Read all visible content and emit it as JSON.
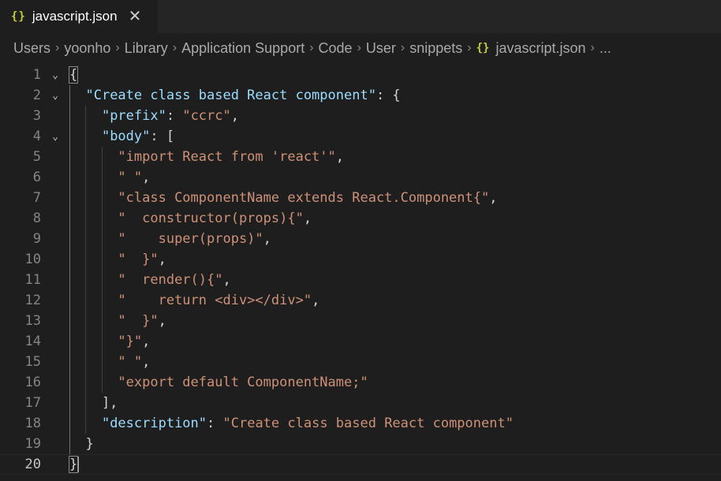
{
  "tab": {
    "icon": "{}",
    "title": "javascript.json",
    "close": "✕"
  },
  "breadcrumb": [
    "Users",
    "yoonho",
    "Library",
    "Application Support",
    "Code",
    "User",
    "snippets"
  ],
  "breadcrumb_file": "javascript.json",
  "breadcrumb_more": "...",
  "colors": {
    "string": "#ce9178",
    "key": "#9cdcfe",
    "punct": "#d4d4d4"
  },
  "lines": [
    {
      "n": "1",
      "fold": true,
      "tokens": [
        {
          "t": "{",
          "c": "pun"
        }
      ]
    },
    {
      "n": "2",
      "fold": true,
      "tokens": [
        {
          "t": "  ",
          "c": "pun"
        },
        {
          "t": "\"Create class based React component\"",
          "c": "key"
        },
        {
          "t": ": {",
          "c": "pun"
        }
      ]
    },
    {
      "n": "3",
      "fold": false,
      "tokens": [
        {
          "t": "    ",
          "c": "pun"
        },
        {
          "t": "\"prefix\"",
          "c": "key"
        },
        {
          "t": ": ",
          "c": "pun"
        },
        {
          "t": "\"ccrc\"",
          "c": "str"
        },
        {
          "t": ",",
          "c": "pun"
        }
      ]
    },
    {
      "n": "4",
      "fold": true,
      "tokens": [
        {
          "t": "    ",
          "c": "pun"
        },
        {
          "t": "\"body\"",
          "c": "key"
        },
        {
          "t": ": [",
          "c": "pun"
        }
      ]
    },
    {
      "n": "5",
      "fold": false,
      "tokens": [
        {
          "t": "      ",
          "c": "pun"
        },
        {
          "t": "\"import React from 'react'\"",
          "c": "str"
        },
        {
          "t": ",",
          "c": "pun"
        }
      ]
    },
    {
      "n": "6",
      "fold": false,
      "tokens": [
        {
          "t": "      ",
          "c": "pun"
        },
        {
          "t": "\" \"",
          "c": "str"
        },
        {
          "t": ",",
          "c": "pun"
        }
      ]
    },
    {
      "n": "7",
      "fold": false,
      "tokens": [
        {
          "t": "      ",
          "c": "pun"
        },
        {
          "t": "\"class ComponentName extends React.Component{\"",
          "c": "str"
        },
        {
          "t": ",",
          "c": "pun"
        }
      ]
    },
    {
      "n": "8",
      "fold": false,
      "tokens": [
        {
          "t": "      ",
          "c": "pun"
        },
        {
          "t": "\"  constructor(props){\"",
          "c": "str"
        },
        {
          "t": ",",
          "c": "pun"
        }
      ]
    },
    {
      "n": "9",
      "fold": false,
      "tokens": [
        {
          "t": "      ",
          "c": "pun"
        },
        {
          "t": "\"    super(props)\"",
          "c": "str"
        },
        {
          "t": ",",
          "c": "pun"
        }
      ]
    },
    {
      "n": "10",
      "fold": false,
      "tokens": [
        {
          "t": "      ",
          "c": "pun"
        },
        {
          "t": "\"  }\"",
          "c": "str"
        },
        {
          "t": ",",
          "c": "pun"
        }
      ]
    },
    {
      "n": "11",
      "fold": false,
      "tokens": [
        {
          "t": "      ",
          "c": "pun"
        },
        {
          "t": "\"  render(){\"",
          "c": "str"
        },
        {
          "t": ",",
          "c": "pun"
        }
      ]
    },
    {
      "n": "12",
      "fold": false,
      "tokens": [
        {
          "t": "      ",
          "c": "pun"
        },
        {
          "t": "\"    return <div></div>\"",
          "c": "str"
        },
        {
          "t": ",",
          "c": "pun"
        }
      ]
    },
    {
      "n": "13",
      "fold": false,
      "tokens": [
        {
          "t": "      ",
          "c": "pun"
        },
        {
          "t": "\"  }\"",
          "c": "str"
        },
        {
          "t": ",",
          "c": "pun"
        }
      ]
    },
    {
      "n": "14",
      "fold": false,
      "tokens": [
        {
          "t": "      ",
          "c": "pun"
        },
        {
          "t": "\"}\"",
          "c": "str"
        },
        {
          "t": ",",
          "c": "pun"
        }
      ]
    },
    {
      "n": "15",
      "fold": false,
      "tokens": [
        {
          "t": "      ",
          "c": "pun"
        },
        {
          "t": "\" \"",
          "c": "str"
        },
        {
          "t": ",",
          "c": "pun"
        }
      ]
    },
    {
      "n": "16",
      "fold": false,
      "tokens": [
        {
          "t": "      ",
          "c": "pun"
        },
        {
          "t": "\"export default ComponentName;\"",
          "c": "str"
        }
      ]
    },
    {
      "n": "17",
      "fold": false,
      "tokens": [
        {
          "t": "    ],",
          "c": "pun"
        }
      ]
    },
    {
      "n": "18",
      "fold": false,
      "tokens": [
        {
          "t": "    ",
          "c": "pun"
        },
        {
          "t": "\"description\"",
          "c": "key"
        },
        {
          "t": ": ",
          "c": "pun"
        },
        {
          "t": "\"Create class based React component\"",
          "c": "str"
        }
      ]
    },
    {
      "n": "19",
      "fold": false,
      "tokens": [
        {
          "t": "  }",
          "c": "pun"
        }
      ]
    },
    {
      "n": "20",
      "fold": false,
      "current": true,
      "tokens": [
        {
          "t": "}",
          "c": "pun"
        }
      ]
    }
  ]
}
